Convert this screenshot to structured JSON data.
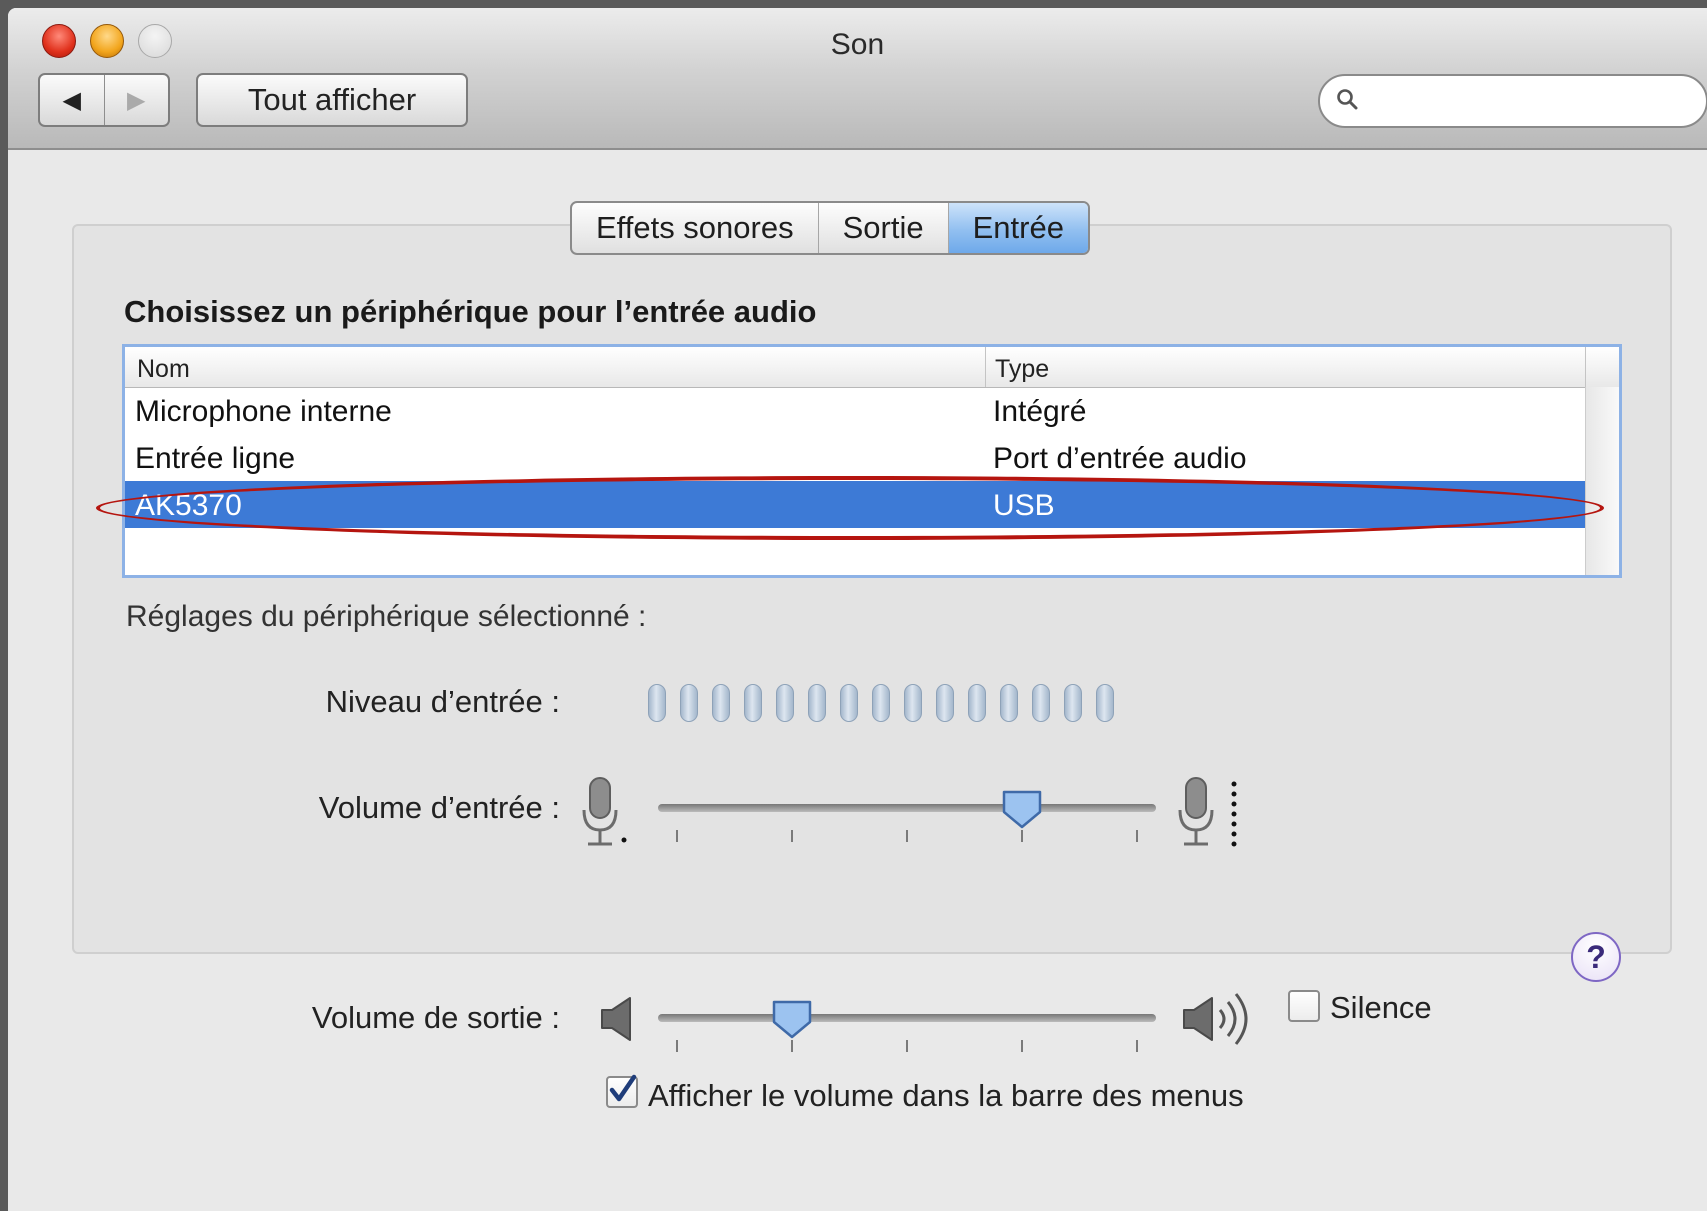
{
  "window": {
    "title": "Son"
  },
  "toolbar": {
    "back_label": "◀",
    "forward_label": "▶",
    "show_all_label": "Tout afficher",
    "search_placeholder": ""
  },
  "tabs": [
    {
      "label": "Effets sonores",
      "active": false
    },
    {
      "label": "Sortie",
      "active": false
    },
    {
      "label": "Entrée",
      "active": true
    }
  ],
  "input": {
    "heading": "Choisissez un périphérique pour l’entrée audio",
    "columns": [
      "Nom",
      "Type"
    ],
    "devices": [
      {
        "name": "Microphone interne",
        "type": "Intégré",
        "selected": false
      },
      {
        "name": "Entrée ligne",
        "type": "Port d’entrée audio",
        "selected": false
      },
      {
        "name": "AK5370",
        "type": "USB",
        "selected": true
      }
    ],
    "settings_label": "Réglages du périphérique sélectionné :",
    "level_label": "Niveau d’entrée :",
    "level_active_bars": 0,
    "level_total_bars": 15,
    "volume_label": "Volume d’entrée :",
    "volume_value": 0.73
  },
  "output": {
    "volume_label": "Volume de sortie :",
    "volume_value": 0.27,
    "mute_label": "Silence",
    "mute_checked": false,
    "show_in_menubar_label": "Afficher le volume dans la barre des menus",
    "show_in_menubar_checked": true
  },
  "help": {
    "label": "?"
  },
  "colors": {
    "selection": "#3d7ad6",
    "annotation": "#b5150f",
    "active_tab": "#91bff0"
  }
}
